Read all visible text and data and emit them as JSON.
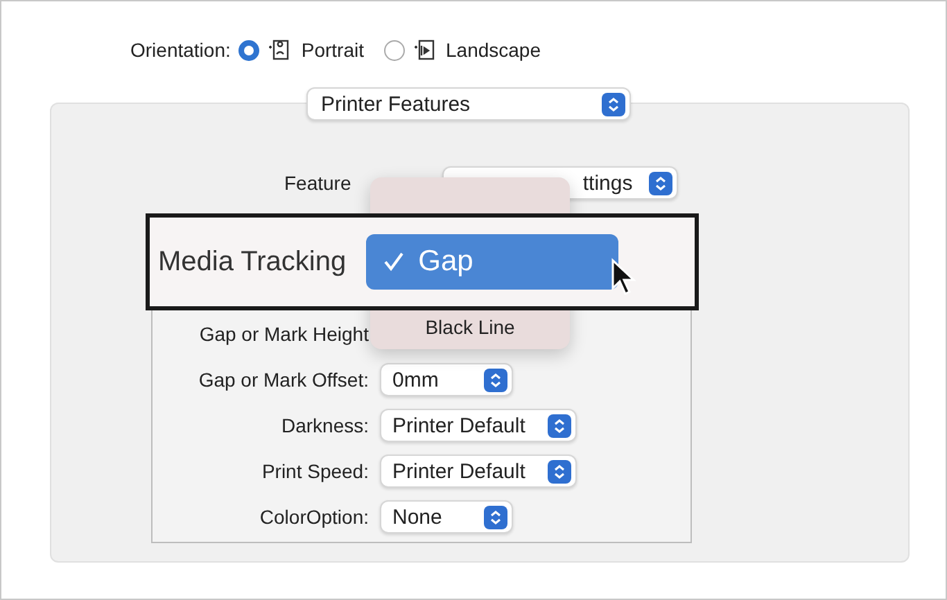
{
  "orientation": {
    "label": "Orientation:",
    "options": [
      {
        "label": "Portrait",
        "kind": "portrait",
        "selected": true
      },
      {
        "label": "Landscape",
        "kind": "landscape",
        "selected": false
      }
    ]
  },
  "section_popup": {
    "value": "Printer Features"
  },
  "feature_sets": {
    "label": "Feature",
    "value": "ttings"
  },
  "callout": {
    "label": "Media Tracking"
  },
  "menu": [
    {
      "label": "Gap",
      "selected": true
    },
    {
      "label": "Black Line",
      "selected": false
    }
  ],
  "settings": [
    {
      "label": "Gap or Mark Height"
    },
    {
      "label": "Gap or Mark Offset:",
      "value": "0mm"
    },
    {
      "label": "Darkness:",
      "value": "Printer Default"
    },
    {
      "label": "Print Speed:",
      "value": "Printer Default"
    },
    {
      "label": "ColorOption:",
      "value": "None"
    }
  ]
}
